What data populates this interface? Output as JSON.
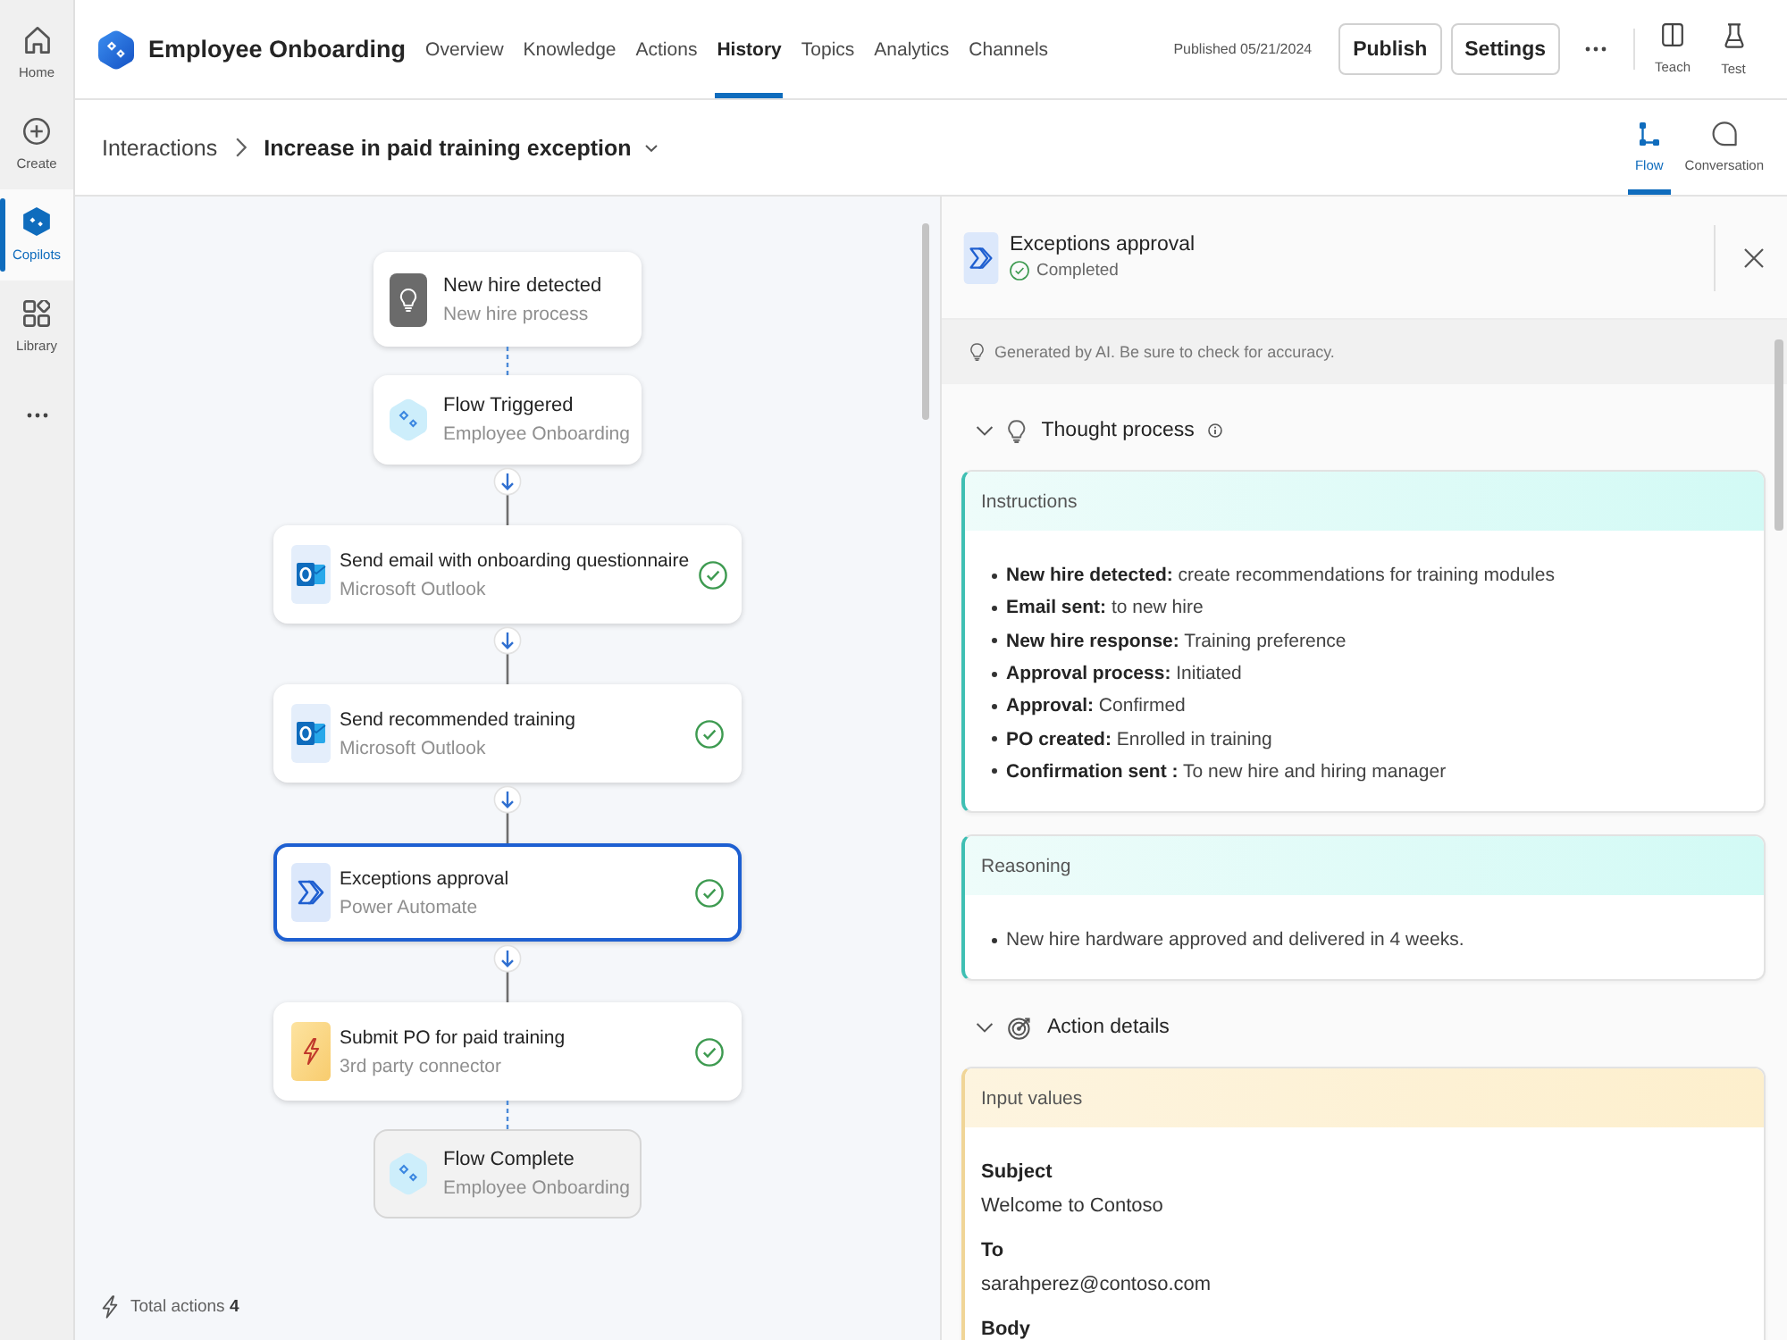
{
  "rail": {
    "items": [
      {
        "label": "Home",
        "selected": false
      },
      {
        "label": "Create",
        "selected": false
      },
      {
        "label": "Copilots",
        "selected": true
      },
      {
        "label": "Library",
        "selected": false
      }
    ]
  },
  "header": {
    "title": "Employee Onboarding",
    "tabs": [
      {
        "label": "Overview",
        "selected": false
      },
      {
        "label": "Knowledge",
        "selected": false
      },
      {
        "label": "Actions",
        "selected": false
      },
      {
        "label": "History",
        "selected": true
      },
      {
        "label": "Topics",
        "selected": false
      },
      {
        "label": "Analytics",
        "selected": false
      },
      {
        "label": "Channels",
        "selected": false
      }
    ],
    "published": "Published 05/21/2024",
    "buttons": [
      "Publish",
      "Settings"
    ],
    "tools": [
      {
        "label": "Teach"
      },
      {
        "label": "Test"
      }
    ]
  },
  "subheader": {
    "breadcrumb": {
      "parent": "Interactions",
      "current": "Increase in paid training exception"
    },
    "views": [
      {
        "label": "Flow",
        "selected": true
      },
      {
        "label": "Conversation",
        "selected": false
      }
    ]
  },
  "flow": {
    "triggers": [
      {
        "title": "New hire detected",
        "subtitle": "New hire process"
      },
      {
        "title": "Flow Triggered",
        "subtitle": "Employee Onboarding"
      }
    ],
    "actions": [
      {
        "title": "Send email with onboarding questionnaire",
        "subtitle": "Microsoft Outlook",
        "completed": true,
        "selected": false
      },
      {
        "title": "Send recommended training",
        "subtitle": "Microsoft Outlook",
        "completed": true,
        "selected": false
      },
      {
        "title": "Exceptions approval",
        "subtitle": "Power Automate",
        "completed": true,
        "selected": true
      },
      {
        "title": "Submit PO for paid training",
        "subtitle": "3rd party connector",
        "completed": true,
        "selected": false
      }
    ],
    "end": {
      "title": "Flow Complete",
      "subtitle": "Employee Onboarding"
    },
    "total": "Total actions **4**"
  },
  "details": {
    "title": "Exceptions approval",
    "status": "Completed",
    "notice": "Generated by AI. Be sure to check for accuracy.",
    "sections": [
      {
        "kind": "thought",
        "title": "Thought process",
        "expanded": true,
        "cards": [
          {
            "kind": "bullets",
            "title": "Instructions",
            "items": [
              "**New hire detected:** create recommendations for training modules",
              "**Email sent:** to new hire",
              "**New hire response:** Training preference",
              "**Approval process:** Initiated",
              "**Approval:** Confirmed",
              "**PO created:** Enrolled in training",
              "**Confirmation sent :** To new hire and hiring manager"
            ]
          },
          {
            "kind": "bullets",
            "title": "Reasoning",
            "items": [
              "New hire hardware approved and delivered in 4 weeks."
            ]
          }
        ]
      },
      {
        "kind": "action",
        "title": "Action details",
        "expanded": true,
        "cards": [
          {
            "kind": "fields",
            "title": "Input values",
            "fields": [
              {
                "label": "Subject",
                "value": "Welcome to Contoso"
              },
              {
                "label": "To",
                "value": "sarahperez@contoso.com"
              },
              {
                "label": "Body"
              }
            ]
          }
        ]
      }
    ]
  }
}
